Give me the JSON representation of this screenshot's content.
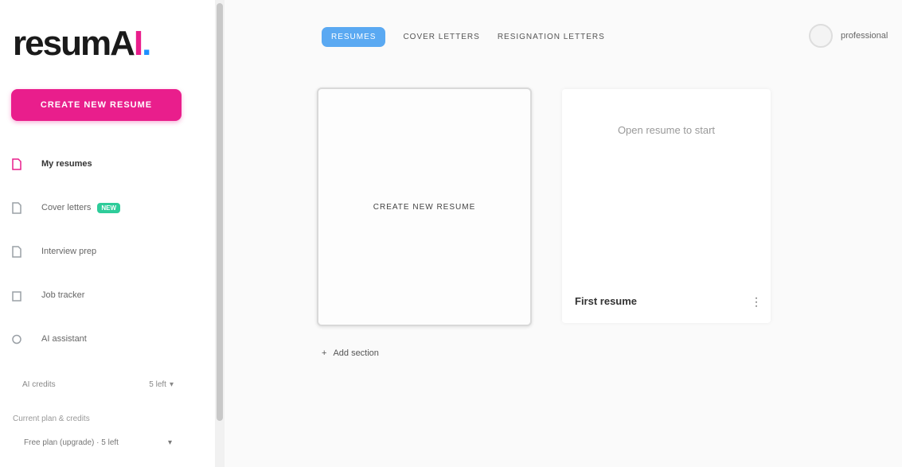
{
  "logo": {
    "text_main": "resumA",
    "text_i": "I",
    "text_dot": "."
  },
  "sidebar": {
    "new_button": "Create new resume",
    "items": [
      {
        "label": "My resumes",
        "icon": "file-icon",
        "active": true,
        "badge": ""
      },
      {
        "label": "Cover letters",
        "icon": "document-icon",
        "active": false,
        "badge": "NEW"
      },
      {
        "label": "Interview prep",
        "icon": "chat-icon",
        "active": false,
        "badge": ""
      },
      {
        "label": "Job tracker",
        "icon": "briefcase-icon",
        "active": false,
        "badge": ""
      },
      {
        "label": "AI assistant",
        "icon": "sparkle-icon",
        "active": false,
        "badge": ""
      }
    ],
    "credits_label": "AI credits",
    "credits_value": "5 left",
    "plan_label": "Current plan & credits",
    "plan_value": "Free plan (upgrade) · 5 left"
  },
  "header": {
    "tabs": [
      {
        "label": "Resumes",
        "active": true
      },
      {
        "label": "Cover letters",
        "active": false
      },
      {
        "label": "Resignation letters",
        "active": false
      }
    ],
    "user_name": "professional"
  },
  "main": {
    "create_card_label": "Create new resume",
    "resume_card": {
      "hint": "Open resume to start",
      "name": "First resume",
      "menu_icon": "kebab-menu-icon"
    },
    "add_section_label": "Add section"
  },
  "colors": {
    "accent_pink": "#e91e8c",
    "accent_blue": "#5aa9f2",
    "badge_green": "#2ecc9a"
  }
}
